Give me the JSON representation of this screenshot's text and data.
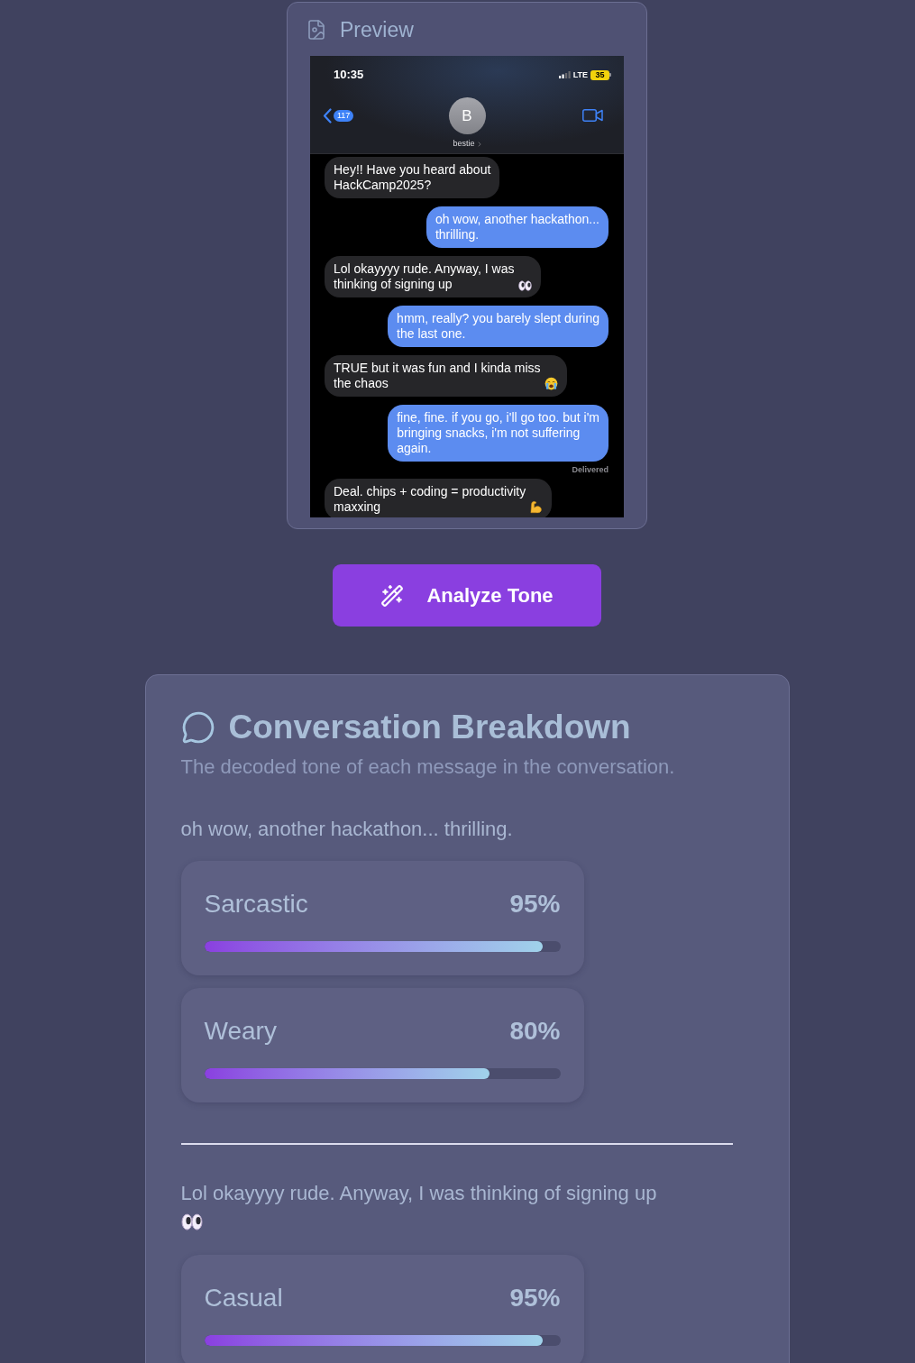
{
  "preview": {
    "title": "Preview",
    "screenshot": {
      "time": "10:35",
      "network": "LTE",
      "battery": "35",
      "back_count": "117",
      "contact": {
        "initial": "B",
        "name": "bestie"
      },
      "messages": [
        {
          "kind": "received",
          "lines": [
            "Hey!! Have you heard about",
            "HackCamp2025?"
          ]
        },
        {
          "kind": "sent",
          "lines": [
            "oh wow, another hackathon...",
            "thrilling."
          ]
        },
        {
          "kind": "received",
          "lines": [
            "Lol okayyyy rude. Anyway, I was",
            "thinking of signing up"
          ],
          "emoji": {
            "kind": "eyes"
          }
        },
        {
          "kind": "sent",
          "lines": [
            "hmm, really? you barely slept during",
            "the last one."
          ]
        },
        {
          "kind": "received",
          "lines": [
            "TRUE but it was fun and I kinda miss",
            "the chaos"
          ],
          "emoji": {
            "kind": "crying"
          }
        },
        {
          "kind": "sent",
          "lines": [
            "fine, fine. if you go, i'll go too. but i'm",
            "bringing snacks, i'm not suffering",
            "again."
          ],
          "status": "Delivered"
        },
        {
          "kind": "received",
          "lines": [
            "Deal. chips + coding = productivity",
            "maxxing"
          ],
          "emoji": {
            "kind": "flexing"
          }
        }
      ]
    }
  },
  "analyze_button": {
    "label": "Analyze Tone"
  },
  "breakdown": {
    "title": "Conversation Breakdown",
    "subtitle": "The decoded tone of each message in the conversation.",
    "messages": [
      {
        "text": "oh wow, another hackathon... thrilling.",
        "tones": [
          {
            "label": "Sarcastic",
            "percent": "95%",
            "level": 0.95
          },
          {
            "label": "Weary",
            "percent": "80%",
            "level": 0.8
          }
        ]
      },
      {
        "text": "Lol okayyyy rude. Anyway, I was thinking of signing up",
        "emoji": {
          "kind": "eyes"
        },
        "tones": [
          {
            "label": "Casual",
            "percent": "95%",
            "level": 0.95
          }
        ]
      }
    ]
  }
}
